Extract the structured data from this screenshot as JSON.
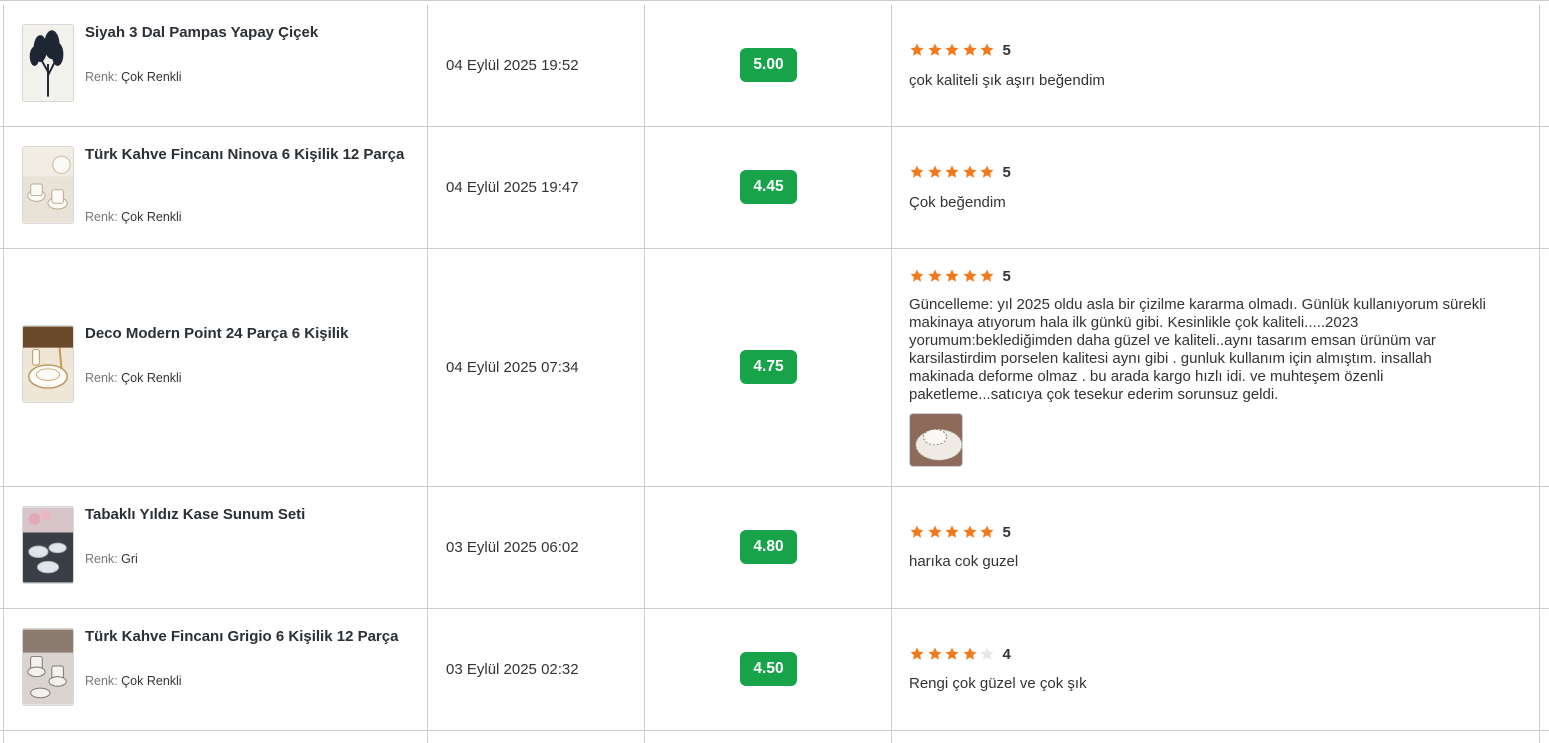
{
  "attr_label": "Renk:",
  "colors": {
    "badge": "#16a34a",
    "star_filled": "#f27a1a",
    "star_empty": "#e6e6e6"
  },
  "rows": [
    {
      "product": "Siyah 3 Dal Pampas Yapay Çiçek",
      "attribute": "Çok Renkli",
      "date": "04 Eylül 2025 19:52",
      "score": "5.00",
      "rating": 5,
      "rating_label": "5",
      "review": "çok kaliteli şık aşırı beğendim",
      "thumb_icon": "pampas-image"
    },
    {
      "product": "Türk Kahve Fincanı Ninova 6 Kişilik 12 Parça",
      "attribute": "Çok Renkli",
      "date": "04 Eylül 2025 19:47",
      "score": "4.45",
      "rating": 5,
      "rating_label": "5",
      "review": "Çok beğendim",
      "thumb_icon": "coffee-cup-image"
    },
    {
      "product": "Deco Modern Point 24 Parça 6 Kişilik",
      "attribute": "Çok Renkli",
      "date": "04 Eylül 2025 07:34",
      "score": "4.75",
      "rating": 5,
      "rating_label": "5",
      "review": "Güncelleme: yıl 2025 oldu asla bir çizilme kararma olmadı. Günlük kullanıyorum sürekli makinaya atıyorum hala ilk günkü gibi. Kesinlikle çok kaliteli.....2023 yorumum:beklediğimden daha güzel ve kaliteli..aynı tasarım emsan ürünüm var karsilastirdim porselen kalitesi aynı gibi . gunluk kullanım için almıştım. insallah makinada deforme olmaz . bu arada kargo hızlı idi. ve muhteşem özenli paketleme...satıcıya çok tesekur ederim sorunsuz geldi.",
      "thumb_icon": "dinnerware-image",
      "review_photo_icon": "review-photo-image"
    },
    {
      "product": "Tabaklı Yıldız Kase Sunum Seti",
      "attribute": "Gri",
      "date": "03 Eylül 2025 06:02",
      "score": "4.80",
      "rating": 5,
      "rating_label": "5",
      "review": "harıka cok guzel",
      "thumb_icon": "glass-bowl-image"
    },
    {
      "product": "Türk Kahve Fincanı Grigio 6 Kişilik 12 Parça",
      "attribute": "Çok Renkli",
      "date": "03 Eylül 2025 02:32",
      "score": "4.50",
      "rating": 4,
      "rating_label": "4",
      "review": "Rengi çok güzel ve çok şık",
      "thumb_icon": "coffee-cup-image"
    }
  ]
}
